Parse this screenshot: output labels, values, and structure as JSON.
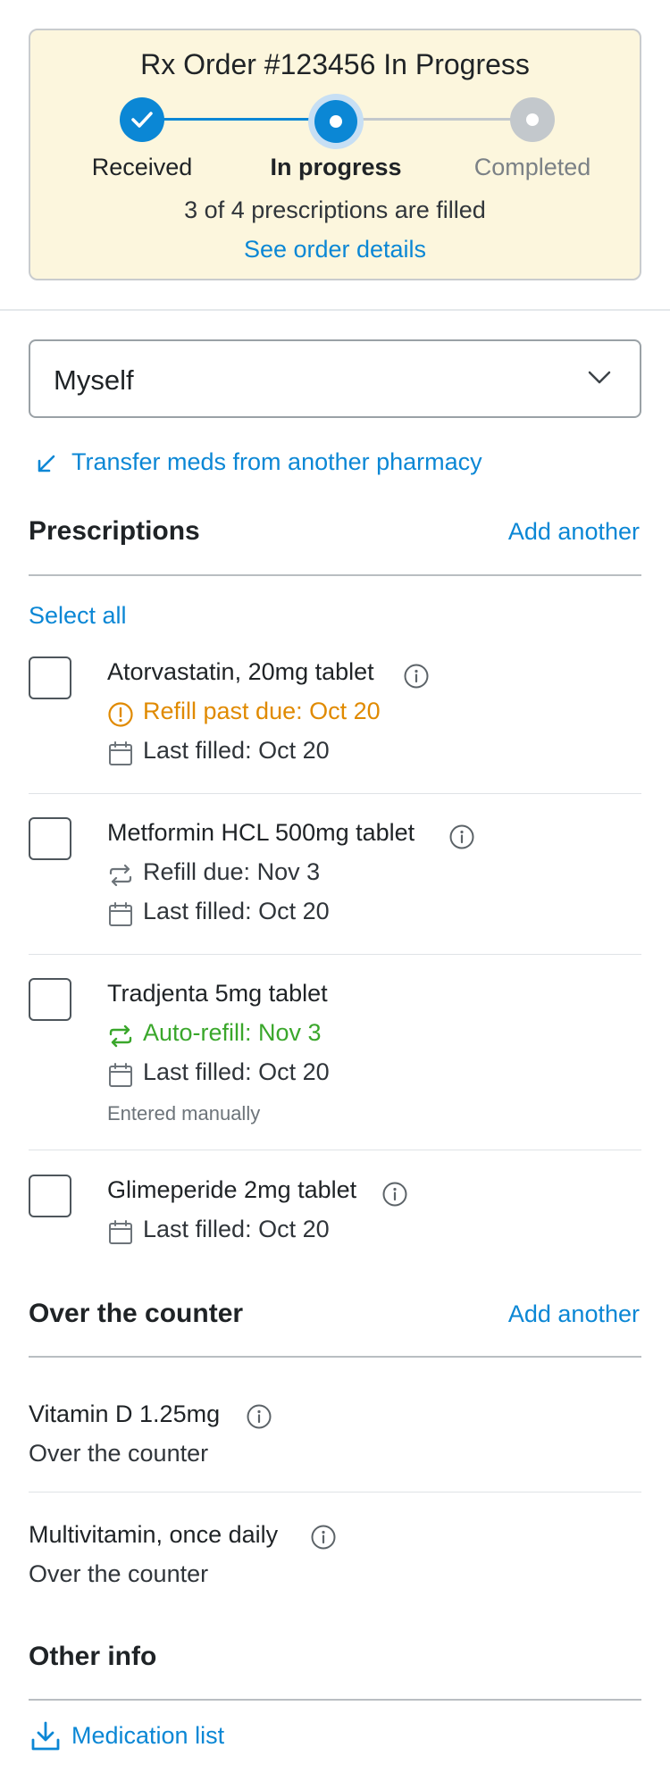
{
  "order": {
    "title": "Rx Order #123456 In Progress",
    "steps": [
      {
        "label": "Received",
        "state": "done"
      },
      {
        "label": "In progress",
        "state": "current"
      },
      {
        "label": "Completed",
        "state": "pending"
      }
    ],
    "summary": "3 of 4 prescriptions are filled",
    "details_link": "See order details"
  },
  "patient_select": {
    "value": "Myself"
  },
  "transfer_link": "Transfer meds from another pharmacy",
  "prescriptions": {
    "title": "Prescriptions",
    "add_label": "Add another",
    "select_all": "Select all",
    "items": [
      {
        "name": "Atorvastatin, 20mg tablet",
        "status": "Refill past due: Oct 20",
        "status_kind": "warning",
        "last_filled": "Last filled: Oct 20"
      },
      {
        "name": "Metformin HCL 500mg tablet",
        "status": "Refill due: Nov 3",
        "status_kind": "refill",
        "last_filled": "Last filled: Oct 20"
      },
      {
        "name": "Tradjenta 5mg tablet",
        "status": "Auto-refill: Nov 3",
        "status_kind": "auto",
        "last_filled": "Last filled: Oct 20",
        "note": "Entered manually"
      },
      {
        "name": "Glimeperide 2mg tablet",
        "last_filled": "Last filled: Oct 20"
      }
    ]
  },
  "otc": {
    "title": "Over the counter",
    "add_label": "Add another",
    "items": [
      {
        "name": "Vitamin D 1.25mg",
        "sub": "Over the counter"
      },
      {
        "name": "Multivitamin, once daily",
        "sub": "Over the counter"
      }
    ]
  },
  "other_info": {
    "title": "Other info",
    "medication_list": "Medication list"
  },
  "colors": {
    "accent": "#0b87d5",
    "warning": "#e08a00",
    "success": "#3aa72b",
    "order_bg": "#fcf6dd"
  }
}
